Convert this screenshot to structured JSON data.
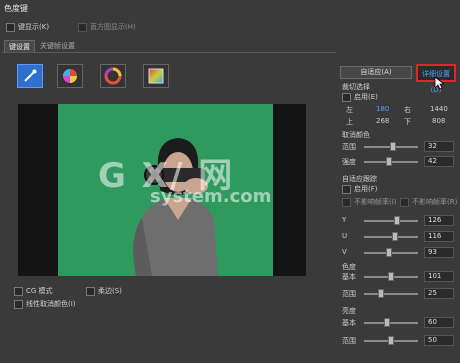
{
  "window": {
    "title": "色度键"
  },
  "top_options": [
    {
      "label": "键显示(K)",
      "enabled": true
    },
    {
      "label": "直方图显示(H)",
      "enabled": false
    }
  ],
  "tabs": [
    {
      "label": "键设置",
      "active": true
    },
    {
      "label": "关键帧设置",
      "active": false
    }
  ],
  "tools": [
    {
      "icon": "eyedropper-icon",
      "active": true
    },
    {
      "icon": "color-wheel-icon",
      "active": false
    },
    {
      "icon": "hue-ring-icon",
      "active": false
    },
    {
      "icon": "gradient-square-icon",
      "active": false
    }
  ],
  "bottom_options": [
    {
      "label": "CG 模式"
    },
    {
      "label": "柔边(S)"
    },
    {
      "label": "线性取消颜色(I)"
    }
  ],
  "buttons": {
    "auto": "自适应(A)",
    "detail": "详细设置(D)"
  },
  "crop": {
    "title": "裁切选择",
    "enable_label": "启用(E)",
    "left_label": "左",
    "left": "180",
    "right_label": "右",
    "right": "1440",
    "top_label": "上",
    "top": "268",
    "bottom_label": "下",
    "bottom": "808"
  },
  "cancel_color": {
    "title": "取消颜色",
    "range_label": "范围",
    "range": "32",
    "strength_label": "强度",
    "strength": "42"
  },
  "auto_track": {
    "title": "自适应跟踪",
    "enable_label": "启用(F)",
    "opt1": "不影响帧率(I)",
    "opt2": "不影响帧率(R)",
    "y_label": "Y",
    "y": "126",
    "u_label": "U",
    "u": "116",
    "v_label": "V",
    "v": "93"
  },
  "chroma": {
    "title": "色度",
    "base_label": "基本",
    "base": "101",
    "range_label": "范围",
    "range": "25"
  },
  "luma": {
    "title": "亮度",
    "base_label": "基本",
    "base": "60",
    "range_label": "范围",
    "range": "50"
  },
  "watermark": {
    "line1": "G X/ 网",
    "line2": "system.com"
  },
  "colors": {
    "accent": "#2f6fd0",
    "highlight": "#e0262b",
    "green_screen": "#2e9a5e"
  }
}
